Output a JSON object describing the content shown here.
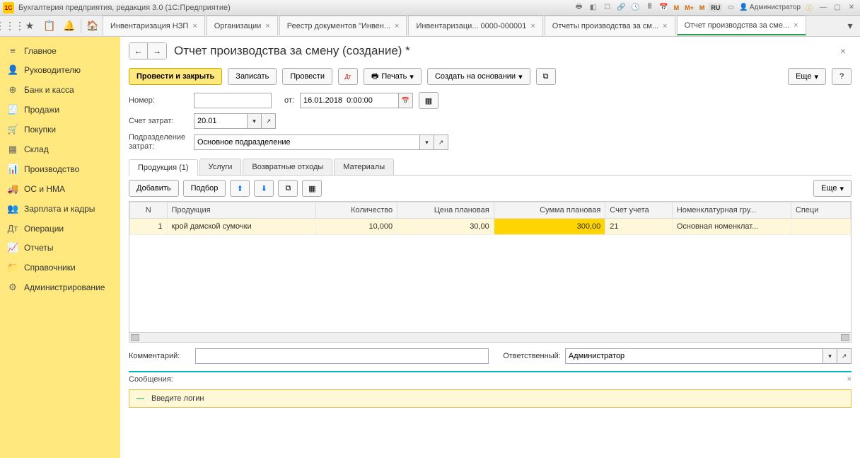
{
  "titlebar": {
    "app_title": "Бухгалтерия предприятия, редакция 3.0  (1С:Предприятие)",
    "lang": "RU",
    "user": "Администратор"
  },
  "tabs": [
    {
      "label": "Инвентаризация НЗП"
    },
    {
      "label": "Организации"
    },
    {
      "label": "Реестр документов \"Инвен..."
    },
    {
      "label": "Инвентаризаци... 0000-000001"
    },
    {
      "label": "Отчеты производства за см..."
    },
    {
      "label": "Отчет производства за сме...",
      "active": true
    }
  ],
  "sidebar": [
    {
      "icon": "≡",
      "label": "Главное"
    },
    {
      "icon": "👤",
      "label": "Руководителю"
    },
    {
      "icon": "⊕",
      "label": "Банк и касса"
    },
    {
      "icon": "🧾",
      "label": "Продажи"
    },
    {
      "icon": "🛒",
      "label": "Покупки"
    },
    {
      "icon": "▦",
      "label": "Склад"
    },
    {
      "icon": "📊",
      "label": "Производство"
    },
    {
      "icon": "🚚",
      "label": "ОС и НМА"
    },
    {
      "icon": "👥",
      "label": "Зарплата и кадры"
    },
    {
      "icon": "Дт",
      "label": "Операции"
    },
    {
      "icon": "📈",
      "label": "Отчеты"
    },
    {
      "icon": "📁",
      "label": "Справочники"
    },
    {
      "icon": "⚙",
      "label": "Администрирование"
    }
  ],
  "page": {
    "title": "Отчет производства за смену (создание) *"
  },
  "actions": {
    "post_close": "Провести и закрыть",
    "save": "Записать",
    "post": "Провести",
    "print": "Печать",
    "create_based": "Создать на основании",
    "more": "Еще"
  },
  "form": {
    "number_label": "Номер:",
    "number_value": "",
    "from_label": "от:",
    "date_value": "16.01.2018  0:00:00",
    "account_label": "Счет затрат:",
    "account_value": "20.01",
    "dept_label": "Подразделение затрат:",
    "dept_value": "Основное подразделение"
  },
  "doc_tabs": [
    {
      "label": "Продукция (1)",
      "active": true
    },
    {
      "label": "Услуги"
    },
    {
      "label": "Возвратные отходы"
    },
    {
      "label": "Материалы"
    }
  ],
  "table_actions": {
    "add": "Добавить",
    "select": "Подбор",
    "more": "Еще"
  },
  "table": {
    "columns": [
      "N",
      "Продукция",
      "Количество",
      "Цена плановая",
      "Сумма плановая",
      "Счет учета",
      "Номенклатурная гру...",
      "Специ"
    ],
    "rows": [
      {
        "n": "1",
        "product": "крой дамской сумочки",
        "qty": "10,000",
        "price": "30,00",
        "sum": "300,00",
        "account": "21",
        "group": "Основная номенклат...",
        "spec": ""
      }
    ]
  },
  "bottom": {
    "comment_label": "Комментарий:",
    "comment_value": "",
    "responsible_label": "Ответственный:",
    "responsible_value": "Администратор"
  },
  "messages": {
    "header": "Сообщения:",
    "items": [
      "Введите логин"
    ]
  }
}
